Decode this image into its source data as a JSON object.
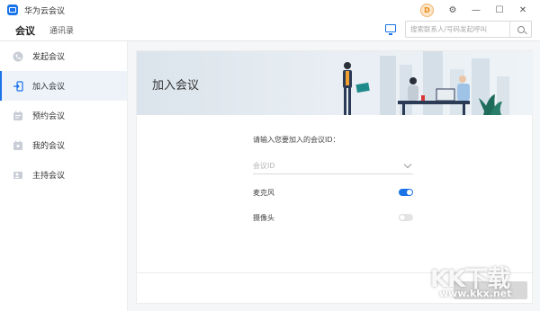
{
  "app": {
    "title": "华为云会议",
    "avatar_letter": "D"
  },
  "window_controls": {
    "settings": "⚙",
    "minimize": "—",
    "maximize": "☐",
    "close": "✕"
  },
  "nav": {
    "tabs": [
      {
        "label": "会议"
      },
      {
        "label": "通讯录"
      }
    ]
  },
  "search": {
    "placeholder": "搜索联系人/号码发起呼叫"
  },
  "sidebar": {
    "items": [
      {
        "label": "发起会议",
        "icon": "phone-icon"
      },
      {
        "label": "加入会议",
        "icon": "join-icon",
        "active": true
      },
      {
        "label": "预约会议",
        "icon": "calendar-icon"
      },
      {
        "label": "我的会议",
        "icon": "my-meetings-icon"
      },
      {
        "label": "主持会议",
        "icon": "host-icon"
      }
    ]
  },
  "join": {
    "banner_title": "加入会议",
    "prompt": "请输入您要加入的会议ID：",
    "id_placeholder": "会议ID",
    "mic_label": "麦克风",
    "mic_on": true,
    "camera_label": "摄像头",
    "camera_on": false
  },
  "watermark": {
    "text": "KK下载",
    "url": "www.kkx.net"
  },
  "colors": {
    "accent": "#1a73e8",
    "sidebar_active_bg": "#eef3fa",
    "content_bg": "#f5f6f8"
  }
}
